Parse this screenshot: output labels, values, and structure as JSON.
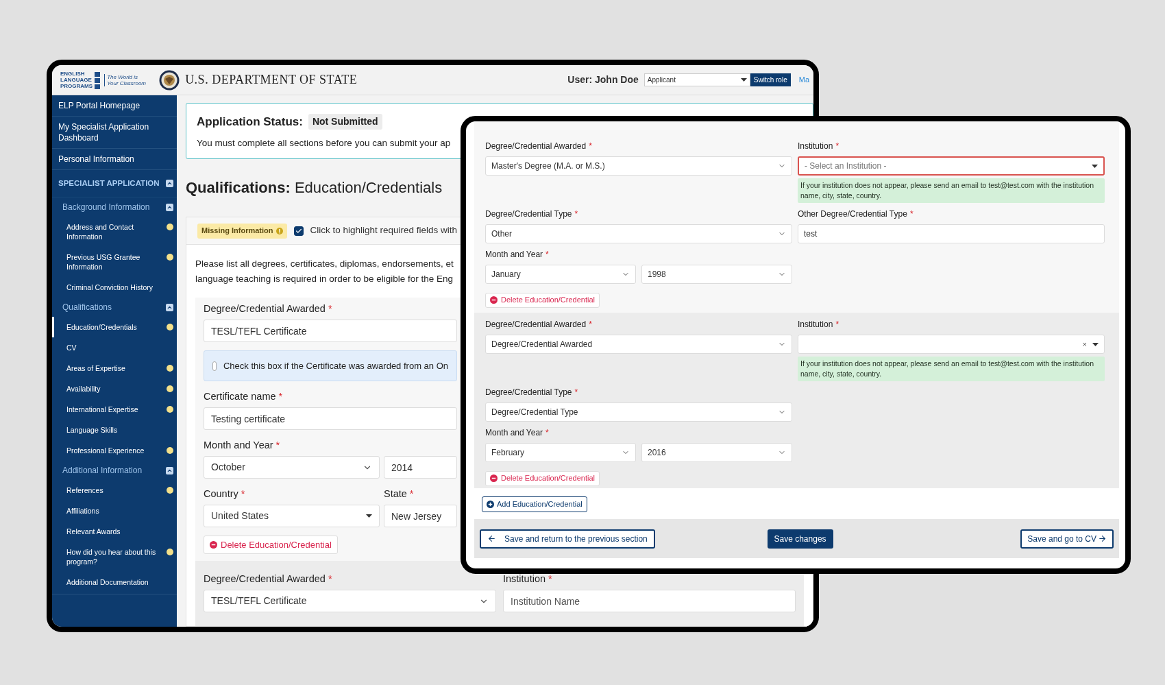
{
  "back_window": {
    "header": {
      "logo_text": [
        "ENGLISH",
        "LANGUAGE",
        "PROGRAMS"
      ],
      "tagline": "The World is Your Classroom",
      "agency": "U.S. DEPARTMENT OF STATE",
      "user": "User: John Doe",
      "role": "Applicant",
      "switch_button": "Switch role",
      "link": "Ma"
    },
    "sidebar": {
      "links": [
        {
          "label": "ELP Portal Homepage",
          "selected": false
        },
        {
          "label": "My Specialist Application Dashboard",
          "selected": false
        },
        {
          "label": "Personal Information",
          "selected": false
        }
      ],
      "section": {
        "label": "SPECIALIST APPLICATION",
        "expanded": true,
        "groups": [
          {
            "label": "Background Information",
            "expanded": true,
            "children": [
              {
                "label": "Address and Contact Information",
                "selected": false,
                "missing": true
              },
              {
                "label": "Previous USG Grantee Information",
                "selected": false,
                "missing": true
              },
              {
                "label": "Criminal Conviction History",
                "selected": false,
                "missing": false
              }
            ]
          },
          {
            "label": "Qualifications",
            "expanded": true,
            "children": [
              {
                "label": "Education/Credentials",
                "selected": true,
                "missing": true
              },
              {
                "label": "CV",
                "selected": false,
                "missing": false
              },
              {
                "label": "Areas of Expertise",
                "selected": false,
                "missing": true
              },
              {
                "label": "Availability",
                "selected": false,
                "missing": true
              },
              {
                "label": "International Expertise",
                "selected": false,
                "missing": true
              },
              {
                "label": "Language Skills",
                "selected": false,
                "missing": false
              },
              {
                "label": "Professional Experience",
                "selected": false,
                "missing": true
              }
            ]
          },
          {
            "label": "Additional Information",
            "expanded": true,
            "children": [
              {
                "label": "References",
                "selected": false,
                "missing": true
              },
              {
                "label": "Affiliations",
                "selected": false,
                "missing": false
              },
              {
                "label": "Relevant Awards",
                "selected": false,
                "missing": false
              },
              {
                "label": "How did you hear about this program?",
                "selected": false,
                "missing": true
              },
              {
                "label": "Additional Documentation",
                "selected": false,
                "missing": false
              }
            ]
          }
        ]
      }
    },
    "status": {
      "label": "Application Status:",
      "badge": "Not Submitted",
      "message": "You must complete all sections before you can submit your ap"
    },
    "heading": "**Qualifications:** Education/Credentials",
    "missing_badge": "Missing Information",
    "highlight": {
      "checked": true,
      "label": "Click to highlight required fields with"
    },
    "intro": [
      "Please list all degrees, certificates, diplomas, endorsements, et",
      "language teaching is required in order to be eligible for the Eng"
    ],
    "entries": [
      {
        "rows": [
          [
            {
              "kind": "input",
              "label": "Degree/Credential Awarded",
              "mark": "*",
              "value": "TESL/TEFL Certificate"
            }
          ],
          [
            {
              "kind": "checkbox",
              "label": "Check this box if the Certificate was awarded from an On",
              "checked": false
            }
          ],
          [
            {
              "kind": "input",
              "label": "Certificate name",
              "mark": "*",
              "value": "Testing certificate"
            }
          ],
          [
            {
              "kind": "date",
              "label": "Month and Year",
              "mark": "*",
              "month": {
                "kind": "select",
                "value": "October"
              },
              "year": {
                "kind": "input",
                "value": "2014"
              }
            }
          ],
          [
            {
              "kind": "pair",
              "items": [
                {
                  "kind": "dropdown",
                  "label": "Country",
                  "mark": "*",
                  "value": "United States"
                },
                {
                  "kind": "input",
                  "label": "State",
                  "mark": "*",
                  "value": "New Jersey"
                }
              ]
            }
          ]
        ],
        "delete_button": "Delete Education/Credential"
      },
      {
        "rows": [
          [
            {
              "kind": "select",
              "label": "Degree/Credential Awarded",
              "mark": "*",
              "value": "TESL/TEFL Certificate"
            },
            {
              "kind": "input",
              "label": "Institution",
              "mark": "*",
              "placeholder": "Institution Name"
            }
          ]
        ]
      }
    ]
  },
  "front_window": {
    "entries": [
      {
        "rows": [
          [
            {
              "kind": "select",
              "label": "Degree/Credential Awarded",
              "mark": "*",
              "value": "Master's Degree (M.A. or M.S.)"
            },
            {
              "kind": "dropdown",
              "label": "Institution",
              "mark": "*",
              "placeholder": "- Select an Institution -",
              "invalid": true,
              "note": "If your institution does not appear, please send an email to test@test.com with the institution name, city, state, country."
            }
          ],
          [
            {
              "kind": "select",
              "label": "Degree/Credential Type",
              "mark": "*",
              "value": "Other"
            },
            {
              "kind": "input",
              "label": "Other Degree/Credential Type",
              "mark": "*",
              "value": "test"
            }
          ],
          [
            {
              "kind": "date",
              "label": "Month and Year",
              "mark": "*",
              "month": {
                "kind": "select",
                "value": "January"
              },
              "year": {
                "kind": "select",
                "value": "1998"
              }
            }
          ]
        ],
        "delete_button": "Delete Education/Credential"
      },
      {
        "rows": [
          [
            {
              "kind": "select",
              "label": "Degree/Credential Awarded",
              "mark": "*",
              "value": "Degree/Credential Awarded"
            },
            {
              "kind": "dropdown",
              "label": "Institution",
              "mark": "*",
              "clear": "×",
              "invalid": false,
              "note": "If your institution does not appear, please send an email to test@test.com with the institution name, city, state, country."
            }
          ],
          [
            {
              "kind": "select",
              "label": "Degree/Credential Type",
              "mark": "*",
              "value": "Degree/Credential Type"
            }
          ],
          [
            {
              "kind": "date",
              "label": "Month and Year",
              "mark": "*",
              "month": {
                "kind": "select",
                "value": "February"
              },
              "year": {
                "kind": "select",
                "value": "2016"
              }
            }
          ]
        ],
        "delete_button": "Delete Education/Credential"
      }
    ],
    "add_button": "Add Education/Credential",
    "footer": {
      "back_button": "Save and return to the previous section",
      "save_button": "Save changes",
      "next_button": "Save and go to CV"
    }
  }
}
